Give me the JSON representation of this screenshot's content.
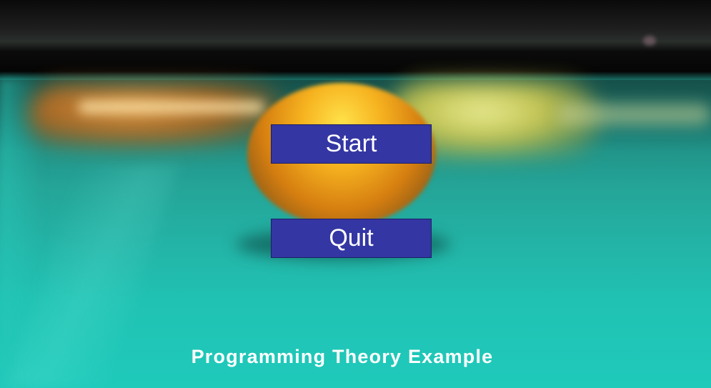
{
  "menu": {
    "start_label": "Start",
    "quit_label": "Quit"
  },
  "footer": {
    "title": "Programming Theory Example"
  },
  "colors": {
    "button_fill": "#3436a3",
    "button_text": "#ffffff",
    "title_text": "#ffffff",
    "table_felt": "#20c2b3"
  }
}
